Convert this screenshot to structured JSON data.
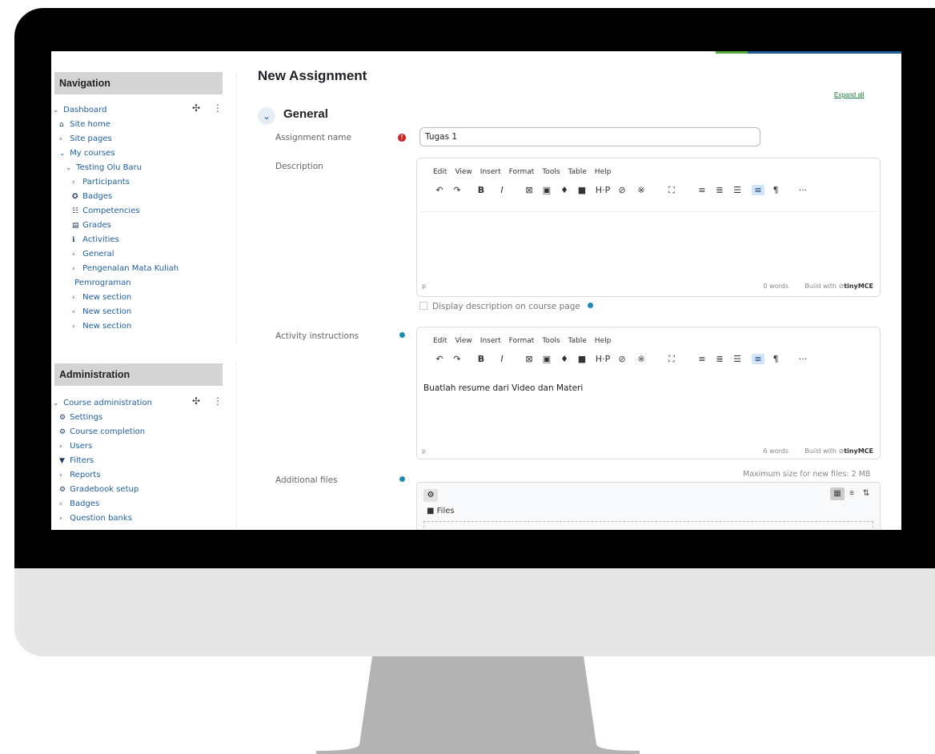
{
  "navigation": {
    "title": "Navigation",
    "items": [
      {
        "icon": "chevron-down",
        "label": "Dashboard"
      },
      {
        "icon": "home",
        "label": "Site home"
      },
      {
        "icon": "chevron-right",
        "label": "Site pages"
      },
      {
        "icon": "chevron-down",
        "label": "My courses"
      },
      {
        "icon": "chevron-down",
        "label": "Testing Olu Baru"
      },
      {
        "icon": "chevron-right",
        "label": "Participants"
      },
      {
        "icon": "badge",
        "label": "Badges"
      },
      {
        "icon": "competencies",
        "label": "Competencies"
      },
      {
        "icon": "grades",
        "label": "Grades"
      },
      {
        "icon": "info",
        "label": "Activities"
      },
      {
        "icon": "chevron-right",
        "label": "General"
      },
      {
        "icon": "chevron-right",
        "label": "Pengenalan Mata Kuliah"
      },
      {
        "icon": "",
        "label": "Pemrograman"
      },
      {
        "icon": "chevron-right",
        "label": "New section"
      },
      {
        "icon": "chevron-right",
        "label": "New section"
      },
      {
        "icon": "chevron-right",
        "label": "New section"
      }
    ]
  },
  "administration": {
    "title": "Administration",
    "items": [
      {
        "icon": "chevron-down",
        "label": "Course administration"
      },
      {
        "icon": "gear",
        "label": "Settings"
      },
      {
        "icon": "gear",
        "label": "Course completion"
      },
      {
        "icon": "chevron-right",
        "label": "Users"
      },
      {
        "icon": "filter",
        "label": "Filters"
      },
      {
        "icon": "chevron-right",
        "label": "Reports"
      },
      {
        "icon": "gear",
        "label": "Gradebook setup"
      },
      {
        "icon": "chevron-right",
        "label": "Badges"
      },
      {
        "icon": "chevron-right",
        "label": "Question banks"
      }
    ]
  },
  "main": {
    "title": "New Assignment",
    "expand_all": "Expand all",
    "section_title": "General",
    "fields": {
      "name_label": "Assignment name",
      "name_value": "Tugas 1",
      "description_label": "Description",
      "instructions_label": "Activity instructions",
      "files_label": "Additional files"
    },
    "editor_menu": [
      "Edit",
      "View",
      "Insert",
      "Format",
      "Tools",
      "Table",
      "Help"
    ],
    "description_editor": {
      "content": "",
      "path": "p",
      "words": "0 words",
      "build": "Build with",
      "brand": "tinyMCE"
    },
    "instructions_editor": {
      "content": "Buatlah resume dari Video dan Materi",
      "path": "p",
      "words": "6 words",
      "build": "Build with",
      "brand": "tinyMCE"
    },
    "display_description": "Display description on course page",
    "max_size": "Maximum size for new files: 2 MB",
    "files_folder": "Files"
  },
  "colors": {
    "link": "#1f5fa0",
    "required": "#cc2222",
    "help": "#1f8ab3",
    "accent_green": "#59b13e"
  }
}
